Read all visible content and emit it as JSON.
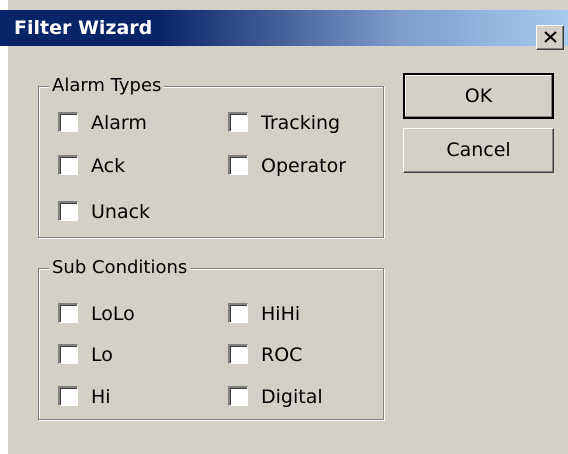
{
  "window": {
    "title": "Filter Wizard",
    "close_icon": "close-x-icon"
  },
  "buttons": {
    "ok_label": "OK",
    "cancel_label": "Cancel"
  },
  "alarm_types": {
    "legend": "Alarm Types",
    "items": [
      {
        "label": "Alarm",
        "checked": false
      },
      {
        "label": "Tracking",
        "checked": false
      },
      {
        "label": "Ack",
        "checked": false
      },
      {
        "label": "Operator",
        "checked": false
      },
      {
        "label": "Unack",
        "checked": false
      }
    ]
  },
  "sub_conditions": {
    "legend": "Sub Conditions",
    "items": [
      {
        "label": "LoLo",
        "checked": false
      },
      {
        "label": "HiHi",
        "checked": false
      },
      {
        "label": "Lo",
        "checked": false
      },
      {
        "label": "ROC",
        "checked": false
      },
      {
        "label": "Hi",
        "checked": false
      },
      {
        "label": "Digital",
        "checked": false
      }
    ]
  },
  "colors": {
    "dialog_face": "#d4d0c8",
    "titlebar_start": "#0a246a",
    "titlebar_end": "#a6caf0",
    "title_text": "#ffffff"
  }
}
